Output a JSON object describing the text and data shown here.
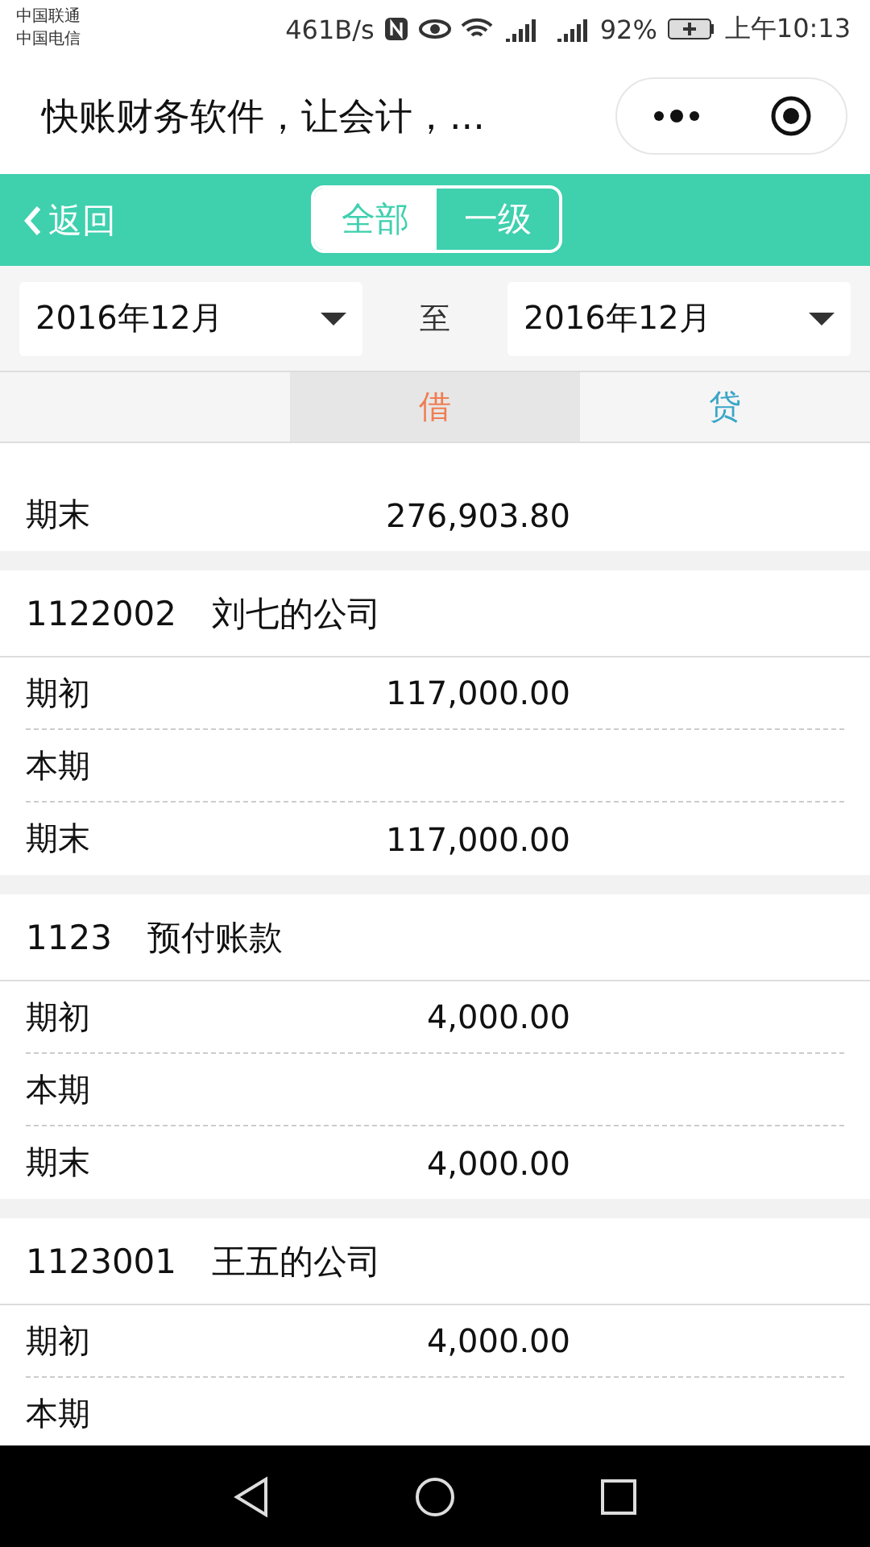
{
  "status_bar": {
    "carriers": [
      "中国联通",
      "中国电信"
    ],
    "speed": "461B/s",
    "battery": "92%",
    "time": "上午10:13"
  },
  "title_bar": {
    "title": "快账财务软件，让会计，..."
  },
  "header": {
    "back": "返回",
    "segments": [
      {
        "label": "全部",
        "selected": true
      },
      {
        "label": "一级",
        "selected": false
      }
    ]
  },
  "date_range": {
    "from": "2016年12月",
    "separator": "至",
    "to": "2016年12月"
  },
  "columns": [
    {
      "label": "借",
      "selected": true
    },
    {
      "label": "贷",
      "selected": false
    }
  ],
  "groups": [
    {
      "rows": [
        {
          "label": "期末",
          "debit": "276,903.80"
        }
      ]
    },
    {
      "code": "1122002",
      "name": "刘七的公司",
      "rows": [
        {
          "label": "期初",
          "debit": "117,000.00"
        },
        {
          "label": "本期",
          "debit": ""
        },
        {
          "label": "期末",
          "debit": "117,000.00"
        }
      ]
    },
    {
      "code": "1123",
      "name": "预付账款",
      "rows": [
        {
          "label": "期初",
          "debit": "4,000.00"
        },
        {
          "label": "本期",
          "debit": ""
        },
        {
          "label": "期末",
          "debit": "4,000.00"
        }
      ]
    },
    {
      "code": "1123001",
      "name": "王五的公司",
      "rows": [
        {
          "label": "期初",
          "debit": "4,000.00"
        },
        {
          "label": "本期",
          "debit": ""
        }
      ]
    }
  ]
}
